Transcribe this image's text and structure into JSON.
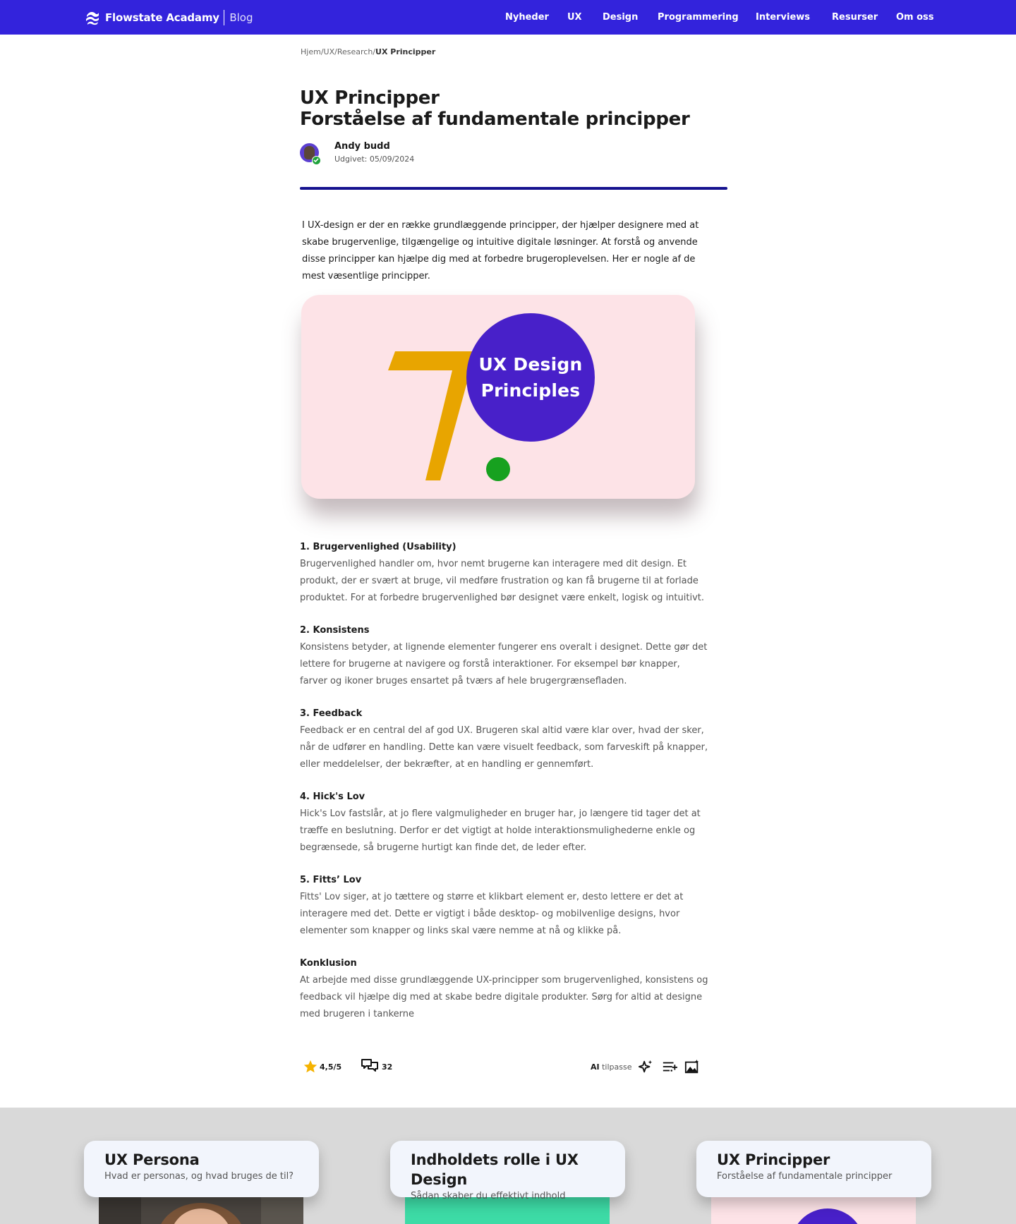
{
  "header": {
    "brand_name": "Flowstate Acadamy",
    "brand_sub": "Blog",
    "nav": [
      "Nyheder",
      "UX",
      "Design",
      "Programmering",
      "Interviews",
      "Resurser",
      "Om oss"
    ]
  },
  "breadcrumb": {
    "items": [
      "Hjem",
      "UX",
      "Research"
    ],
    "current": "UX Principper",
    "separator": "/"
  },
  "article": {
    "title_line1": "UX Principper",
    "title_line2": "Forståelse af fundamentale principper",
    "author": "Andy budd",
    "published": "Udgivet: 05/09/2024",
    "intro": "I UX-design er der en række grundlæggende principper, der hjælper designere med at skabe brugervenlige, tilgængelige og intuitive digitale løsninger. At forstå og anvende disse principper kan hjælpe dig med at forbedre brugeroplevelsen. Her er nogle af de mest væsentlige principper.",
    "hero": {
      "number": "7",
      "line1": "UX Design",
      "line2": "Principles",
      "colors": {
        "background": "#fde3e7",
        "number": "#e8a500",
        "circle": "#4820c9",
        "dot": "#17a11f"
      }
    },
    "sections": [
      {
        "heading": "1. Brugervenlighed (Usability)",
        "body": "Brugervenlighed handler om, hvor nemt brugerne kan interagere med dit design. Et produkt, der er svært at bruge, vil medføre frustration og kan få brugerne til at forlade produktet. For at forbedre brugervenlighed bør designet være enkelt, logisk og intuitivt."
      },
      {
        "heading": "2. Konsistens",
        "body": "Konsistens betyder, at lignende elementer fungerer ens overalt i designet. Dette gør det lettere for brugerne at navigere og forstå interaktioner. For eksempel bør knapper, farver og ikoner bruges ensartet på tværs af hele brugergrænsefladen."
      },
      {
        "heading": "3. Feedback",
        "body": "Feedback er en central del af god UX. Brugeren skal altid være klar over, hvad der sker, når de udfører en handling. Dette kan være visuelt feedback, som farveskift på knapper, eller meddelelser, der bekræfter, at en handling er gennemført."
      },
      {
        "heading": "4. Hick's Lov",
        "body": "Hick's Lov fastslår, at jo flere valgmuligheder en bruger har, jo længere tid tager det at træffe en beslutning. Derfor er det vigtigt at holde interaktionsmulighederne enkle og begrænsede, så brugerne hurtigt kan finde det, de leder efter."
      },
      {
        "heading": "5. Fitts’ Lov",
        "body": "Fitts' Lov siger, at jo tættere og større et klikbart element er, desto lettere er det at interagere med det. Dette er vigtigt i både desktop- og mobilvenlige designs, hvor elementer som knapper og links skal være nemme at nå og klikke på."
      },
      {
        "heading": "Konklusion",
        "body": "At arbejde med disse grundlæggende UX-principper som brugervenlighed, konsistens og feedback vil hjælpe dig med at skabe bedre digitale produkter. Sørg for altid at designe med brugeren i tankerne"
      }
    ],
    "rating": "4,5/5",
    "comments": "32",
    "ai_prefix": "AI",
    "ai_label": "tilpasse"
  },
  "related": [
    {
      "title": "UX Persona",
      "subtitle": "Hvad er personas, og hvad bruges de til?"
    },
    {
      "title": "Indholdets rolle i UX Design",
      "subtitle": "Sådan skaber du effektivt indhold"
    },
    {
      "title": "UX Principper",
      "subtitle": "Forståelse af fundamentale principper"
    }
  ],
  "colors": {
    "nav_background": "#3323dc",
    "divider": "#15128f",
    "star": "#f5b301",
    "related_background": "#d9d9d9"
  }
}
